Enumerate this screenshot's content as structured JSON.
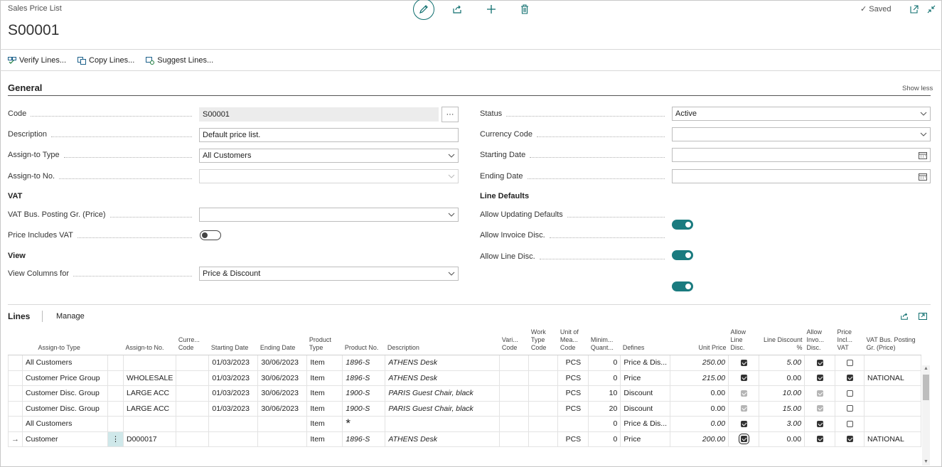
{
  "header": {
    "breadcrumb": "Sales Price List",
    "title": "S00001",
    "saved": "Saved",
    "icons": [
      "edit-icon",
      "share-icon",
      "add-icon",
      "delete-icon",
      "open-new-window-icon",
      "collapse-icon"
    ]
  },
  "actions": [
    {
      "label": "Verify Lines...",
      "icon": "verify-lines-icon"
    },
    {
      "label": "Copy Lines...",
      "icon": "copy-lines-icon"
    },
    {
      "label": "Suggest Lines...",
      "icon": "suggest-lines-icon"
    }
  ],
  "general": {
    "title": "General",
    "show_less": "Show less",
    "code": {
      "label": "Code",
      "value": "S00001"
    },
    "description": {
      "label": "Description",
      "value": "Default price list."
    },
    "assign_to_type": {
      "label": "Assign-to Type",
      "value": "All Customers"
    },
    "assign_to_no": {
      "label": "Assign-to No.",
      "value": ""
    },
    "vat_heading": "VAT",
    "vat_bus_posting": {
      "label": "VAT Bus. Posting Gr. (Price)",
      "value": ""
    },
    "price_includes_vat": {
      "label": "Price Includes VAT",
      "on": false
    },
    "view_heading": "View",
    "view_columns_for": {
      "label": "View Columns for",
      "value": "Price & Discount"
    },
    "status": {
      "label": "Status",
      "value": "Active"
    },
    "currency_code": {
      "label": "Currency Code",
      "value": ""
    },
    "starting_date": {
      "label": "Starting Date",
      "value": ""
    },
    "ending_date": {
      "label": "Ending Date",
      "value": ""
    },
    "line_defaults_heading": "Line Defaults",
    "allow_updating_defaults": {
      "label": "Allow Updating Defaults",
      "on": true
    },
    "allow_invoice_disc": {
      "label": "Allow Invoice Disc.",
      "on": true
    },
    "allow_line_disc": {
      "label": "Allow Line Disc.",
      "on": true
    }
  },
  "lines": {
    "title": "Lines",
    "manage": "Manage",
    "columns": [
      "Assign-to Type",
      "Assign-to No.",
      "Curre... Code",
      "Starting Date",
      "Ending Date",
      "Product Type",
      "Product No.",
      "Description",
      "Vari... Code",
      "Work Type Code",
      "Unit of Mea... Code",
      "Minim... Quant...",
      "Defines",
      "Unit Price",
      "Allow Line Disc.",
      "Line Discount %",
      "Allow Invo... Disc.",
      "Price Incl... VAT",
      "VAT Bus. Posting Gr. (Price)"
    ],
    "rows": [
      {
        "assign_type": "All Customers",
        "assign_no": "",
        "currency": "",
        "start": "01/03/2023",
        "end": "30/06/2023",
        "ptype": "Item",
        "pno": "1896-S",
        "desc": "ATHENS Desk",
        "vari": "",
        "work": "",
        "uom": "PCS",
        "minq": "0",
        "defines": "Price & Dis...",
        "price": "250.00",
        "price_red": true,
        "allow_line": true,
        "allow_line_grey": false,
        "line_disc": "5.00",
        "disc_red": true,
        "allow_inv": true,
        "allow_inv_grey": false,
        "price_incl": false,
        "vat": ""
      },
      {
        "assign_type": "Customer Price Group",
        "assign_no": "WHOLESALE",
        "currency": "",
        "start": "01/03/2023",
        "end": "30/06/2023",
        "ptype": "Item",
        "pno": "1896-S",
        "desc": "ATHENS Desk",
        "vari": "",
        "work": "",
        "uom": "PCS",
        "minq": "0",
        "defines": "Price",
        "price": "215.00",
        "price_red": true,
        "allow_line": true,
        "allow_line_grey": false,
        "line_disc": "0.00",
        "disc_red": false,
        "allow_inv": true,
        "allow_inv_grey": false,
        "price_incl": true,
        "vat": "NATIONAL"
      },
      {
        "assign_type": "Customer Disc. Group",
        "assign_no": "LARGE ACC",
        "currency": "",
        "start": "01/03/2023",
        "end": "30/06/2023",
        "ptype": "Item",
        "pno": "1900-S",
        "desc": "PARIS Guest Chair, black",
        "vari": "",
        "work": "",
        "uom": "PCS",
        "minq": "10",
        "defines": "Discount",
        "price": "0.00",
        "price_red": false,
        "price_grey": true,
        "allow_line": true,
        "allow_line_grey": true,
        "line_disc": "10.00",
        "disc_red": true,
        "allow_inv": true,
        "allow_inv_grey": true,
        "price_incl": false,
        "vat": ""
      },
      {
        "assign_type": "Customer Disc. Group",
        "assign_no": "LARGE ACC",
        "currency": "",
        "start": "01/03/2023",
        "end": "30/06/2023",
        "ptype": "Item",
        "pno": "1900-S",
        "desc": "PARIS Guest Chair, black",
        "vari": "",
        "work": "",
        "uom": "PCS",
        "minq": "20",
        "defines": "Discount",
        "price": "0.00",
        "price_red": false,
        "price_grey": true,
        "allow_line": true,
        "allow_line_grey": true,
        "line_disc": "15.00",
        "disc_red": true,
        "allow_inv": true,
        "allow_inv_grey": true,
        "price_incl": false,
        "vat": ""
      },
      {
        "assign_type": "All Customers",
        "assign_no": "",
        "currency": "",
        "start": "",
        "end": "",
        "ptype": "Item",
        "pno": "*",
        "pno_required": true,
        "desc": "",
        "vari": "",
        "work": "",
        "uom": "",
        "minq": "0",
        "defines": "Price & Dis...",
        "price": "0.00",
        "price_red": true,
        "allow_line": true,
        "allow_line_grey": false,
        "line_disc": "3.00",
        "disc_red": true,
        "allow_inv": true,
        "allow_inv_grey": false,
        "price_incl": false,
        "vat": ""
      },
      {
        "assign_type": "Customer",
        "assign_no": "D000017",
        "currency": "",
        "start": "",
        "end": "",
        "ptype": "Item",
        "pno": "1896-S",
        "desc": "ATHENS Desk",
        "vari": "",
        "work": "",
        "uom": "PCS",
        "minq": "0",
        "defines": "Price",
        "price": "200.00",
        "price_red": true,
        "allow_line": true,
        "allow_line_grey": false,
        "line_disc": "0.00",
        "disc_red": false,
        "allow_inv": true,
        "allow_inv_grey": false,
        "price_incl": true,
        "vat": "NATIONAL",
        "current": true
      }
    ]
  }
}
